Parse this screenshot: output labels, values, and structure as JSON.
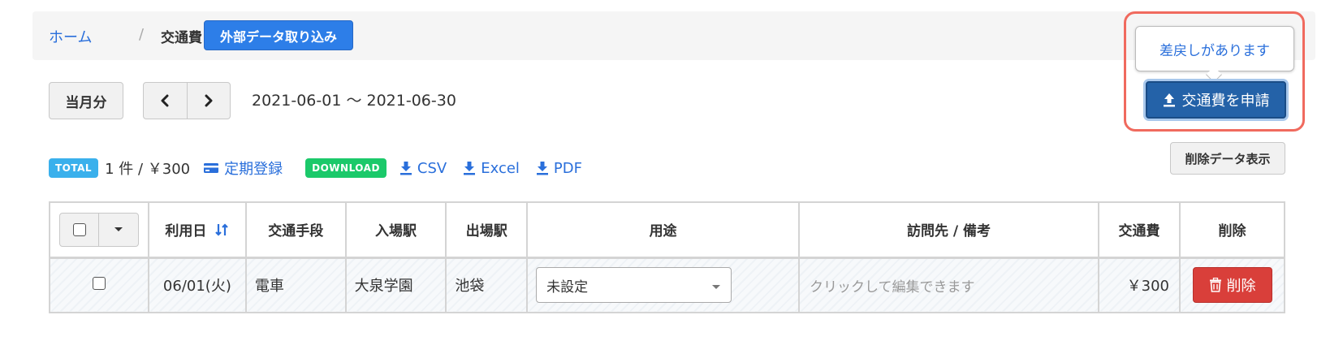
{
  "breadcrumb": {
    "home": "ホーム",
    "separator": "/",
    "current": "交通費",
    "import_button": "外部データ取り込み"
  },
  "period": {
    "current_month_button": "当月分",
    "prev_icon": "chevron-left-icon",
    "next_icon": "chevron-right-icon",
    "range": "2021-06-01 〜 2021-06-30"
  },
  "apply": {
    "notice": "差戻しがあります",
    "button_label": "交通費を申請",
    "button_icon": "upload-icon",
    "highlight_color": "#f06a5e"
  },
  "deleted_data_button": "削除データ表示",
  "summary": {
    "total_badge": "TOTAL",
    "total_text": "1 件 / ￥300",
    "commuter_pass_link": "定期登録",
    "download_badge": "DOWNLOAD",
    "links": [
      "CSV",
      "Excel",
      "PDF"
    ]
  },
  "table": {
    "headers": {
      "date": "利用日",
      "transport": "交通手段",
      "entry_station": "入場駅",
      "exit_station": "出場駅",
      "purpose": "用途",
      "destination": "訪問先 / 備考",
      "fare": "交通費",
      "delete": "削除"
    },
    "rows": [
      {
        "date": "06/01(火)",
        "transport": "電車",
        "entry_station": "大泉学園",
        "exit_station": "池袋",
        "purpose": "未設定",
        "destination_placeholder": "クリックして編集できます",
        "fare": "￥300",
        "delete_label": "削除"
      }
    ]
  },
  "colors": {
    "primary": "#2d7ee8",
    "apply": "#2462a8",
    "danger": "#d93f3a",
    "total_badge": "#3ab0ec",
    "download_badge": "#1bc96a",
    "link": "#2a6fdb"
  }
}
